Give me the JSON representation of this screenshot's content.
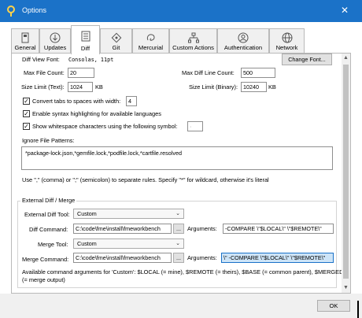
{
  "window": {
    "title": "Options",
    "close": "✕"
  },
  "tabs": [
    {
      "label": "General",
      "icon": "general-icon"
    },
    {
      "label": "Updates",
      "icon": "updates-icon"
    },
    {
      "label": "Diff",
      "icon": "diff-icon",
      "active": true
    },
    {
      "label": "Git",
      "icon": "git-icon"
    },
    {
      "label": "Mercurial",
      "icon": "mercurial-icon"
    },
    {
      "label": "Custom Actions",
      "icon": "custom-actions-icon"
    },
    {
      "label": "Authentication",
      "icon": "authentication-icon"
    },
    {
      "label": "Network",
      "icon": "network-icon"
    }
  ],
  "diff": {
    "view_font_label": "Diff View Font:",
    "view_font_value": "Consolas, 11pt",
    "change_font": "Change Font...",
    "max_file_count_label": "Max File Count:",
    "max_file_count": "20",
    "max_line_count_label": "Max Diff Line Count:",
    "max_line_count": "500",
    "size_text_label": "Size Limit (Text):",
    "size_text": "1024",
    "size_text_unit": "KB",
    "size_binary_label": "Size Limit (Binary):",
    "size_binary": "10240",
    "size_binary_unit": "KB",
    "convert_tabs_label": "Convert tabs to spaces with width:",
    "convert_tabs_checked": true,
    "tab_width": "4",
    "syntax_label": "Enable syntax highlighting for available languages",
    "syntax_checked": true,
    "whitespace_label": "Show whitespace characters using the following symbol:",
    "whitespace_checked": true,
    "whitespace_symbol": "·",
    "ignore_label": "Ignore File Patterns:",
    "ignore_patterns": "*package-lock.json,*gemfile.lock,*podfile.lock,*cartfile.resolved",
    "ignore_hint": "Use \",\" (comma) or \";\" (semicolon) to separate rules. Specify \"*\" for wildcard, otherwise it's literal"
  },
  "external": {
    "group_label": "External Diff / Merge",
    "diff_tool_label": "External Diff Tool:",
    "diff_tool": "Custom",
    "diff_command_label": "Diff Command:",
    "diff_command": "C:\\code\\fme\\install\\fmeworkbench",
    "browse": "...",
    "diff_args_label": "Arguments:",
    "diff_args": "-COMPARE \\\"$LOCAL\\\" \\\"$REMOTE\\\"",
    "merge_tool_label": "Merge Tool:",
    "merge_tool": "Custom",
    "merge_command_label": "Merge Command:",
    "merge_command": "C:\\code\\fme\\install\\fmeworkbench",
    "merge_args_label": "Arguments:",
    "merge_args": "\\\" -COMPARE \\\"$LOCAL\\\" \\\"$REMOTE\\\"",
    "hint_line1": "Available command arguments for 'Custom': $LOCAL (= mine), $REMOTE (= theirs), $BASE (= common parent), $MERGED",
    "hint_line2": "(= merge output)"
  },
  "footer": {
    "ok": "OK"
  },
  "colors": {
    "titlebar": "#1b72c8",
    "selection": "#cde4f7"
  }
}
